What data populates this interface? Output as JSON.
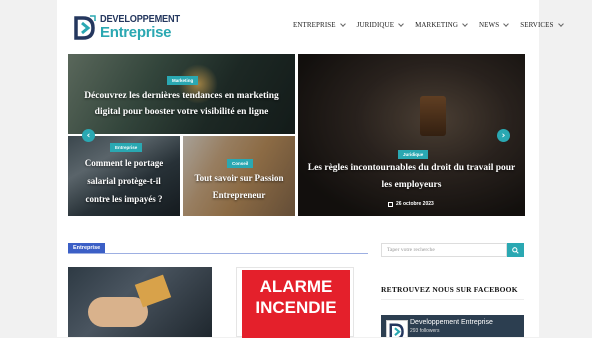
{
  "logo": {
    "line1": "DEVELOPPEMENT",
    "line2": "Entreprise"
  },
  "nav": [
    {
      "label": "ENTREPRISE"
    },
    {
      "label": "JURIDIQUE"
    },
    {
      "label": "MARKETING"
    },
    {
      "label": "NEWS"
    },
    {
      "label": "SERVICES"
    }
  ],
  "hero": {
    "tile1": {
      "badge": "Marketing",
      "title": "Découvrez les dernières tendances en marketing digital pour booster votre visibilité en ligne"
    },
    "tile2": {
      "badge": "Entreprise",
      "title": "Comment le portage salarial protège-t-il contre les impayés ?"
    },
    "tile3": {
      "badge": "Conseil",
      "title": "Tout savoir sur Passion Entrepreneur"
    },
    "tile4": {
      "badge": "Juridique",
      "title": "Les règles incontournables du droit du travail pour les employeurs",
      "date": "26 octobre 2023"
    },
    "prev_icon": "chevron-left-icon",
    "next_icon": "chevron-right-icon"
  },
  "section": {
    "label": "Entreprise"
  },
  "cards": {
    "card2_text": [
      "ALARME",
      "INCENDIE"
    ]
  },
  "sidebar": {
    "search_placeholder": "Taper votre recherche",
    "facebook_title": "RETROUVEZ NOUS SUR FACEBOOK",
    "facebook_page_name": "Developpement Entreprise",
    "facebook_followers": "293 followers"
  },
  "colors": {
    "accent": "#2aa8b2",
    "section": "#3b5fc6",
    "navy": "#24375e",
    "alarm_red": "#e4202b"
  }
}
